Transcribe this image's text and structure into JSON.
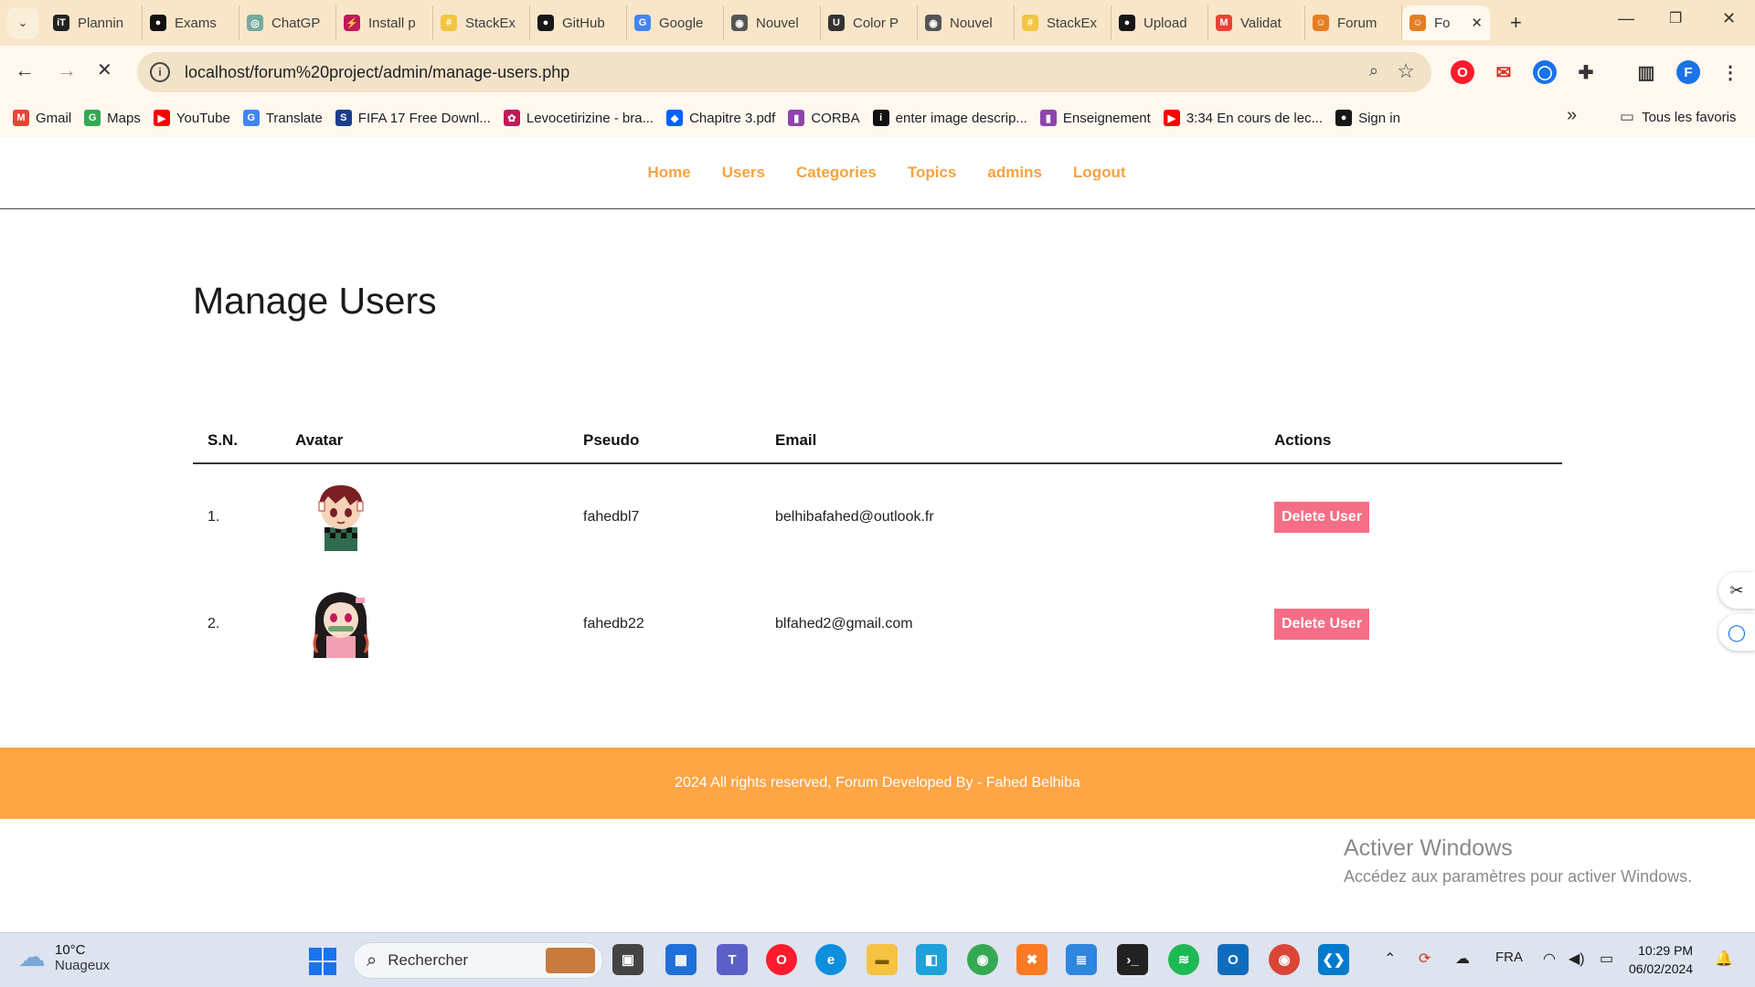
{
  "browser": {
    "tabs": [
      {
        "label": "Plannin",
        "color": "#222222",
        "glyph": "iT"
      },
      {
        "label": "Exams",
        "color": "#111111",
        "glyph": "●"
      },
      {
        "label": "ChatGP",
        "color": "#74aa9c",
        "glyph": "◎"
      },
      {
        "label": "Install p",
        "color": "#c2185b",
        "glyph": "⚡"
      },
      {
        "label": "StackEx",
        "color": "#f4c542",
        "glyph": "#"
      },
      {
        "label": "GitHub",
        "color": "#181717",
        "glyph": "●"
      },
      {
        "label": "Google",
        "color": "#4285f4",
        "glyph": "G"
      },
      {
        "label": "Nouvel",
        "color": "#555555",
        "glyph": "◉"
      },
      {
        "label": "Color P",
        "color": "#333333",
        "glyph": "U"
      },
      {
        "label": "Nouvel",
        "color": "#555555",
        "glyph": "◉"
      },
      {
        "label": "StackEx",
        "color": "#f4c542",
        "glyph": "#"
      },
      {
        "label": "Upload",
        "color": "#181717",
        "glyph": "●"
      },
      {
        "label": "Validat",
        "color": "#ea4335",
        "glyph": "M"
      },
      {
        "label": "Forum",
        "color": "#e67e22",
        "glyph": "☺"
      }
    ],
    "active_tab": {
      "label": "Fo",
      "close": "✕"
    },
    "url": "localhost/forum%20project/admin/manage-users.php",
    "bookmarks": [
      {
        "label": "Gmail",
        "color": "#ea4335",
        "glyph": "M"
      },
      {
        "label": "Maps",
        "color": "#34a853",
        "glyph": "G"
      },
      {
        "label": "YouTube",
        "color": "#ff0000",
        "glyph": "▶"
      },
      {
        "label": "Translate",
        "color": "#4285f4",
        "glyph": "G"
      },
      {
        "label": "FIFA 17 Free Downl...",
        "color": "#1a3e8c",
        "glyph": "S"
      },
      {
        "label": "Levocetirizine - bra...",
        "color": "#c2185b",
        "glyph": "✿"
      },
      {
        "label": "Chapitre 3.pdf",
        "color": "#0061fe",
        "glyph": "◆"
      },
      {
        "label": "CORBA",
        "color": "#8e44ad",
        "glyph": "▮"
      },
      {
        "label": "enter image descrip...",
        "color": "#111111",
        "glyph": "i"
      },
      {
        "label": "Enseignement",
        "color": "#8e44ad",
        "glyph": "▮"
      },
      {
        "label": "3:34 En cours de lec...",
        "color": "#ff0000",
        "glyph": "▶"
      },
      {
        "label": "Sign in",
        "color": "#181717",
        "glyph": "●"
      }
    ],
    "all_bookmarks": "Tous les favoris",
    "more_bookmarks": "»"
  },
  "site": {
    "nav": [
      "Home",
      "Users",
      "Categories",
      "Topics",
      "admins",
      "Logout"
    ],
    "title": "Manage Users",
    "table": {
      "headers": [
        "S.N.",
        "Avatar",
        "Pseudo",
        "Email",
        "Actions"
      ],
      "rows": [
        {
          "sn": "1.",
          "avatar": "tanjiro-avatar",
          "pseudo": "fahedbl7",
          "email": "belhibafahed@outlook.fr",
          "action": "Delete User"
        },
        {
          "sn": "2.",
          "avatar": "nezuko-avatar",
          "pseudo": "fahedb22",
          "email": "blfahed2@gmail.com",
          "action": "Delete User"
        }
      ]
    },
    "footer": "2024 All rights reserved, Forum Developed By - Fahed Belhiba"
  },
  "os": {
    "activate_title": "Activer Windows",
    "activate_sub": "Accédez aux paramètres pour activer Windows.",
    "weather_temp": "10°C",
    "weather_desc": "Nuageux",
    "search_placeholder": "Rechercher",
    "language": "FRA",
    "time": "10:29 PM",
    "date": "06/02/2024"
  },
  "colors": {
    "accent_orange": "#f7a23e",
    "footer_orange": "#fea545",
    "delete_pink": "#f56e86",
    "chrome_tabstrip": "#f9e6c8"
  }
}
